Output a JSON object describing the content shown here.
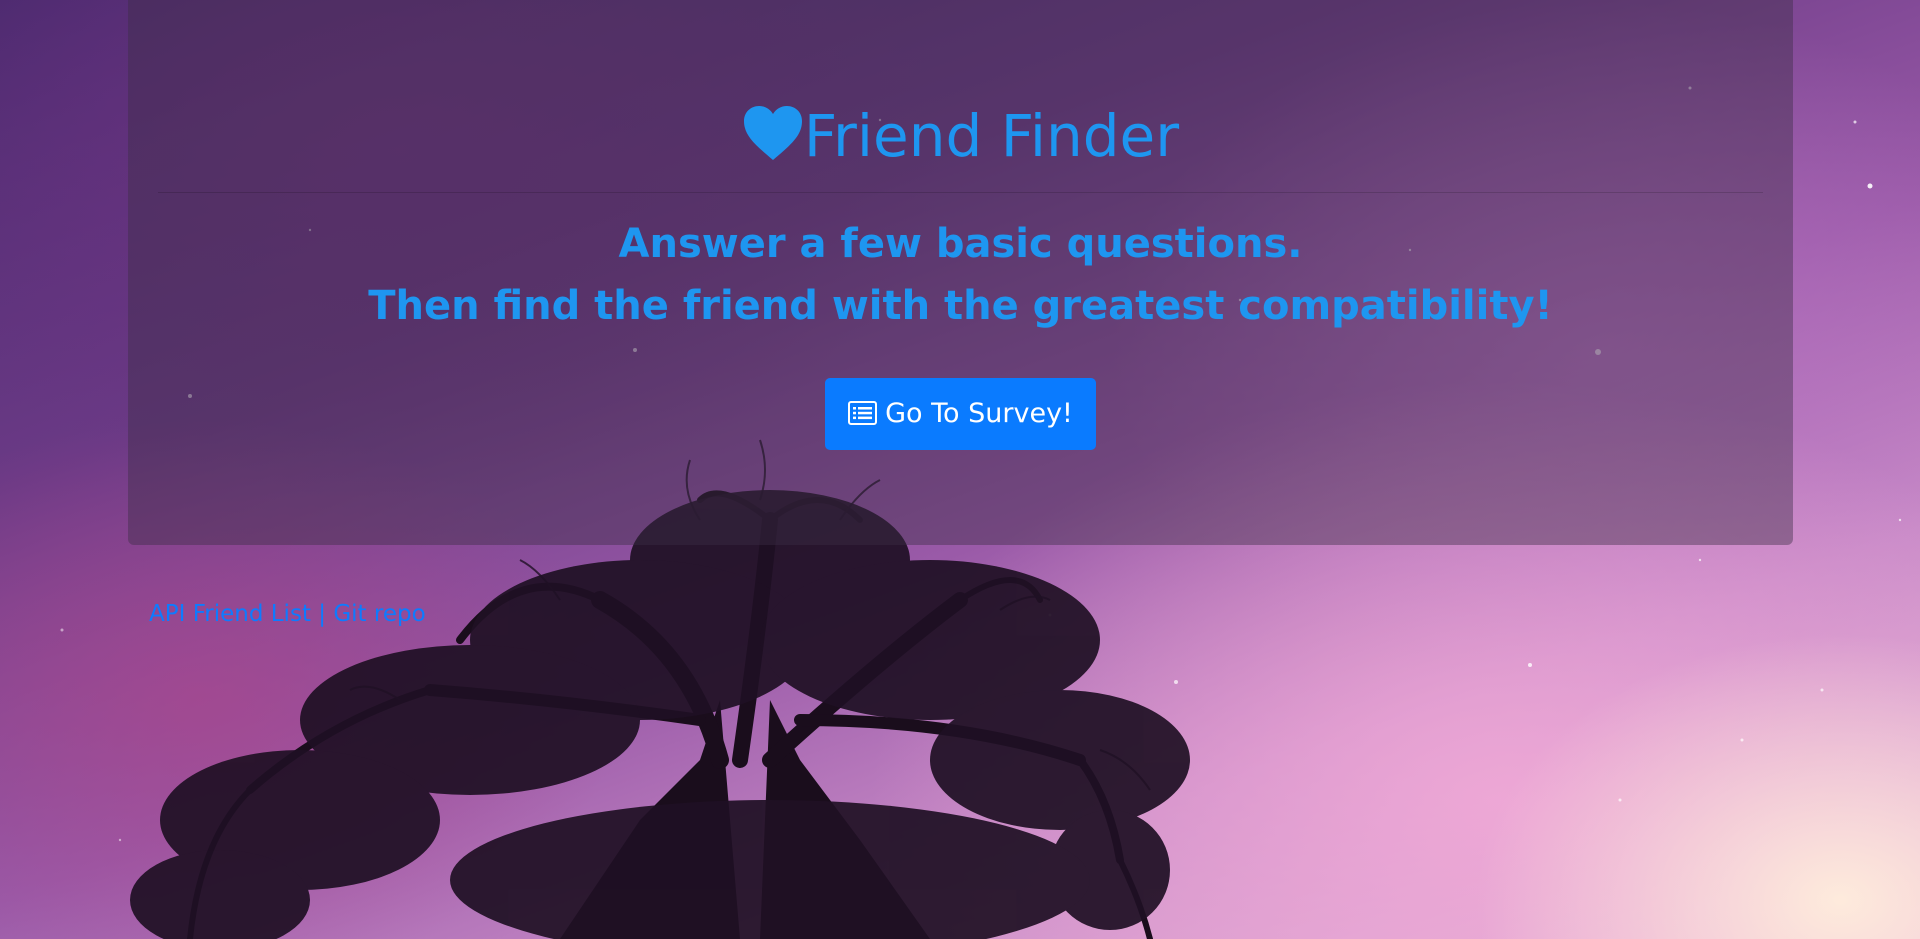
{
  "header": {
    "title": "Friend Finder",
    "title_icon": "heart-icon"
  },
  "intro": {
    "line1": "Answer a few basic questions.",
    "line2": "Then find the friend with the greatest compatibility!"
  },
  "survey_button": {
    "label": "Go To Survey!",
    "icon": "list-alt-icon"
  },
  "footer": {
    "api_link": "API Friend List",
    "separator": "|",
    "git_link": "Git repo"
  },
  "colors": {
    "title_text": "#1e96f0",
    "button_bg": "#0a7bff",
    "link": "#0d7bff"
  }
}
